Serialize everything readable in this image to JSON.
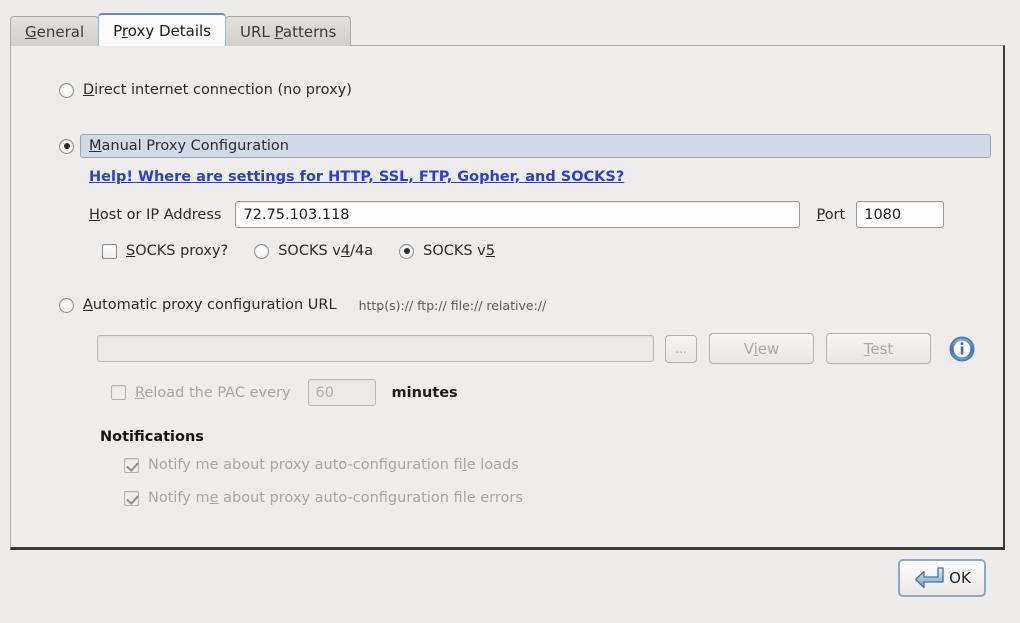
{
  "window": {
    "background_color": "#edecea"
  },
  "tabs": [
    {
      "label_pre": "",
      "label_accel": "G",
      "label_post": "eneral",
      "name": "general",
      "active": false
    },
    {
      "label_pre": "P",
      "label_accel": "r",
      "label_post": "oxy Details",
      "name": "proxy-details",
      "active": true
    },
    {
      "label_pre": "URL ",
      "label_accel": "P",
      "label_post": "atterns",
      "name": "url-patterns",
      "active": false
    }
  ],
  "proxy_mode": {
    "direct": {
      "label_pre": "",
      "label_accel": "D",
      "label_post": "irect internet connection (no proxy)",
      "selected": false
    },
    "manual": {
      "label_pre": "",
      "label_accel": "M",
      "label_post": "anual Proxy Configuration",
      "selected": true,
      "highlight_color": "#d4dae5"
    },
    "automatic": {
      "label_pre": "",
      "label_accel": "A",
      "label_post": "utomatic proxy configuration URL",
      "selected": false
    }
  },
  "help_link": {
    "text": "Help! Where are settings for HTTP, SSL, FTP, Gopher, and SOCKS?",
    "color": "#2b3fd6"
  },
  "manual_settings": {
    "host_label_pre": "",
    "host_label_accel": "H",
    "host_label_post": "ost or IP Address",
    "host_value": "72.75.103.118",
    "host_placeholder": "",
    "port_label_pre": "",
    "port_label_accel": "P",
    "port_label_post": "ort",
    "port_value": "1080",
    "socks_proxy": {
      "label_pre": "",
      "label_accel": "S",
      "label_post": "OCKS proxy?",
      "checked": false
    },
    "socks_v4": {
      "label_pre": "SOCKS v",
      "label_accel": "4",
      "label_post": "/4a",
      "selected": false
    },
    "socks_v5": {
      "label_pre": "SOCKS v",
      "label_accel": "5",
      "label_post": "",
      "selected": true
    }
  },
  "automatic_settings": {
    "scheme_hints": "http(s)://   ftp://   file://   relative://",
    "url_value": "",
    "url_placeholder": "",
    "browse_button_label": "...",
    "view_button": {
      "label_pre": "V",
      "label_accel": "i",
      "label_post": "ew",
      "enabled": false
    },
    "test_button": {
      "label_pre": "",
      "label_accel": "T",
      "label_post": "est",
      "enabled": false
    },
    "info_icon": "info-icon",
    "reload_pac": {
      "label_pre": "",
      "label_accel": "R",
      "label_post": "eload the PAC every",
      "checked": false,
      "enabled": false
    },
    "reload_interval_value": "60",
    "reload_unit_label": "minutes"
  },
  "notifications": {
    "title": "Notifications",
    "items": [
      {
        "label_pre": "Notify me about proxy auto-configuration fi",
        "label_accel": "l",
        "label_post": "e loads",
        "checked": true,
        "enabled": false
      },
      {
        "label_pre": "Notify m",
        "label_accel": "e",
        "label_post": " about proxy auto-configuration file errors",
        "checked": true,
        "enabled": false
      }
    ]
  },
  "footer": {
    "ok_button_label": "OK",
    "ok_button_icon": "enter-arrow-icon"
  }
}
